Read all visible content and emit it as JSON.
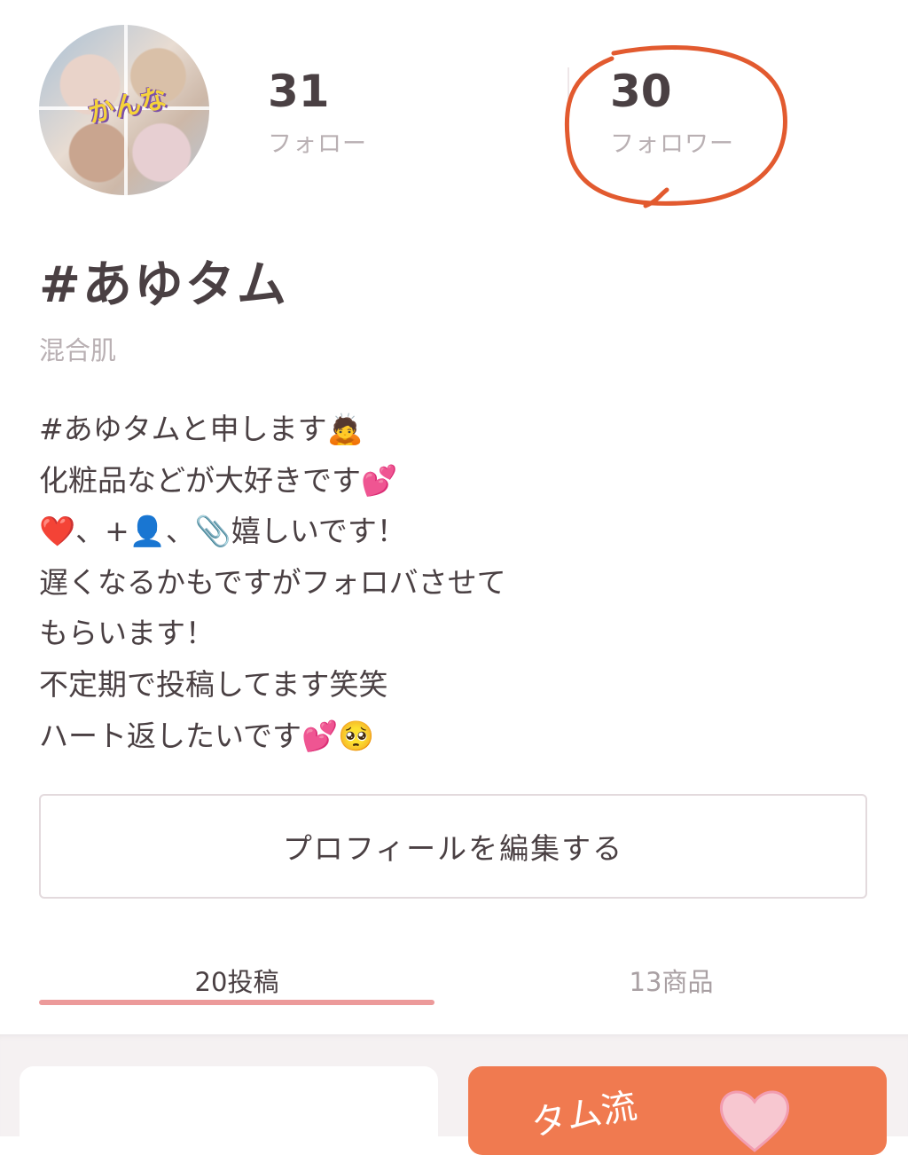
{
  "profile": {
    "avatar_sticker_text": "かんな",
    "name": "#あゆタム",
    "skin_type": "混合肌"
  },
  "stats": {
    "follow": {
      "count": "31",
      "label": "フォロー"
    },
    "follower": {
      "count": "30",
      "label": "フォロワー"
    }
  },
  "bio": [
    "#あゆタムと申します🙇",
    "化粧品などが大好きです💕",
    "❤️、+👤、📎嬉しいです！",
    "遅くなるかもですがフォロバさせて",
    "もらいます！",
    "不定期で投稿してます笑笑",
    "ハート返したいです💕🥺"
  ],
  "edit_button": {
    "label": "プロフィールを編集する"
  },
  "tabs": [
    {
      "label": "20投稿",
      "active": true
    },
    {
      "label": "13商品",
      "active": false
    }
  ],
  "colors": {
    "accent": "#ec9a9a",
    "annotation": "#e25a2f",
    "card_orange": "#f07a50",
    "text": "#4a4043",
    "muted": "#b9b0b3"
  },
  "feed": {
    "card_right_text": "タム流"
  }
}
